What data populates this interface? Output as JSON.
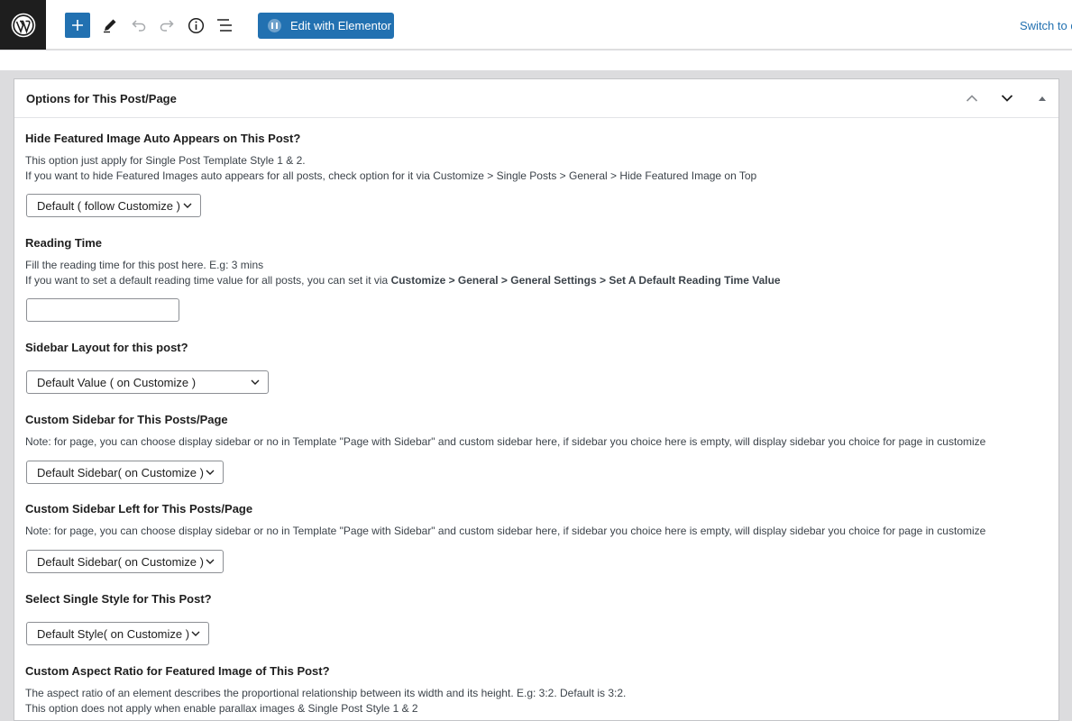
{
  "toolbar": {
    "logo_icon": "wordpress-logo-icon",
    "add_icon": "plus-icon",
    "tools_icon": "pencil-icon",
    "undo_icon": "undo-icon",
    "redo_icon": "redo-icon",
    "details_icon": "info-icon",
    "outline_icon": "list-view-icon",
    "elementor_label": "Edit with Elementor",
    "switch_label": "Switch to d",
    "accent": "#2271b1"
  },
  "metabox": {
    "title": "Options for This Post/Page",
    "fields": {
      "hide_featured": {
        "label": "Hide Featured Image Auto Appears on This Post?",
        "desc_1": "This option just apply for Single Post Template Style 1 & 2.",
        "desc_2": "If you want to hide Featured Images auto appears for all posts, check option for it via Customize > Single Posts > General > Hide Featured Image on Top",
        "value": "Default ( follow Customize )"
      },
      "reading_time": {
        "label": "Reading Time",
        "desc_1": "Fill the reading time for this post here. E.g: 3 mins",
        "desc_2_prefix": "If you want to set a default reading time value for all posts, you can set it via ",
        "desc_2_bold": "Customize > General > General Settings > Set A Default Reading Time Value",
        "value": ""
      },
      "sidebar_layout": {
        "label": "Sidebar Layout for this post?",
        "value": "Default Value ( on Customize )"
      },
      "custom_sidebar": {
        "label": "Custom Sidebar for This Posts/Page",
        "desc": "Note: for page, you can choose display sidebar or no in Template \"Page with Sidebar\" and custom sidebar here, if sidebar you choice here is empty, will display sidebar you choice for page in customize",
        "value": "Default Sidebar( on Customize )"
      },
      "custom_sidebar_left": {
        "label": "Custom Sidebar Left for This Posts/Page",
        "desc": "Note: for page, you can choose display sidebar or no in Template \"Page with Sidebar\" and custom sidebar here, if sidebar you choice here is empty, will display sidebar you choice for page in customize",
        "value": "Default Sidebar( on Customize )"
      },
      "single_style": {
        "label": "Select Single Style for This Post?",
        "value": "Default Style( on Customize )"
      },
      "aspect_ratio": {
        "label": "Custom Aspect Ratio for Featured Image of This Post?",
        "desc_1": "The aspect ratio of an element describes the proportional relationship between its width and its height. E.g: 3:2. Default is 3:2.",
        "desc_2": "This option does not apply when enable parallax images & Single Post Style 1 & 2"
      }
    }
  }
}
